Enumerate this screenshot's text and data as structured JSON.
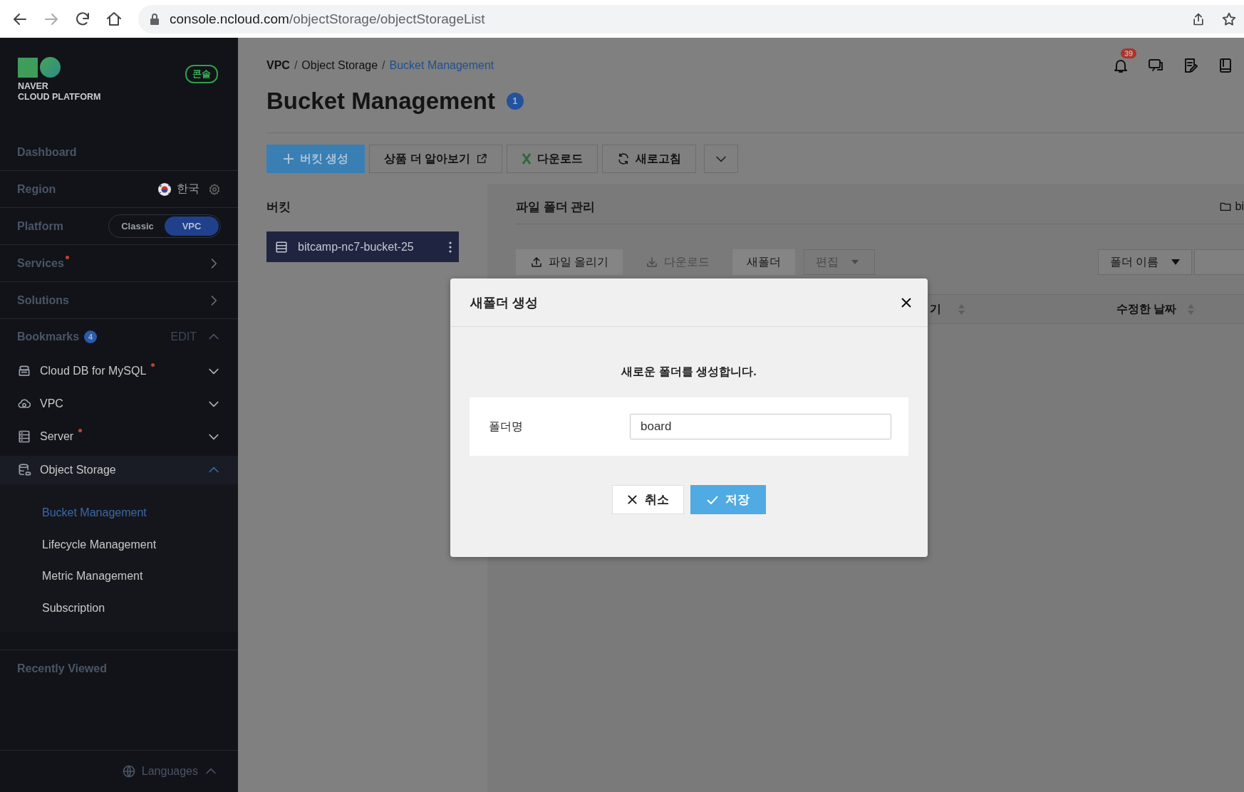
{
  "browser": {
    "url_host": "console.ncloud.com",
    "url_path": "/objectStorage/objectStorageList"
  },
  "sidebar": {
    "logo_lines": [
      "NAVER",
      "CLOUD PLATFORM"
    ],
    "console_badge": "콘솔",
    "nav": [
      {
        "kind": "link",
        "label": "Dashboard"
      },
      {
        "kind": "region",
        "label": "Region",
        "value": "한국"
      },
      {
        "kind": "platform",
        "label": "Platform",
        "options": [
          {
            "label": "Classic",
            "selected": false
          },
          {
            "label": "VPC",
            "selected": true
          }
        ]
      },
      {
        "kind": "menu",
        "label": "Services",
        "dot": true
      },
      {
        "kind": "menu",
        "label": "Solutions",
        "dot": false
      }
    ],
    "bookmarks": {
      "label": "Bookmarks",
      "count": "4",
      "edit": "EDIT",
      "expanded": true,
      "items": [
        {
          "label": "Cloud DB for MySQL",
          "dot": true,
          "expanded": false
        },
        {
          "label": "VPC",
          "dot": false,
          "expanded": false
        },
        {
          "label": "Server",
          "dot": true,
          "expanded": false
        },
        {
          "label": "Object Storage",
          "dot": false,
          "expanded": true,
          "children": [
            {
              "label": "Bucket Management",
              "selected": true
            },
            {
              "label": "Lifecycle Management",
              "selected": false
            },
            {
              "label": "Metric Management",
              "selected": false
            },
            {
              "label": "Subscription",
              "selected": false
            }
          ]
        }
      ]
    },
    "recently_viewed": "Recently Viewed",
    "languages": "Languages"
  },
  "main": {
    "breadcrumb": [
      {
        "label": "VPC",
        "current": false,
        "separator": "/"
      },
      {
        "label": "Object Storage",
        "current": false,
        "separator": "/"
      },
      {
        "label": "Bucket Management",
        "current": true
      }
    ],
    "notification_count": "39",
    "title": "Bucket Management",
    "title_badge": "1",
    "toolbar": [
      {
        "kind": "primary",
        "label": "버킷 생성"
      },
      {
        "kind": "external",
        "label": "상품 더 알아보기"
      },
      {
        "kind": "excel",
        "label": "다운로드"
      },
      {
        "kind": "refresh",
        "label": "새로고침"
      },
      {
        "kind": "more"
      }
    ],
    "buckets": {
      "title": "버킷",
      "items": [
        {
          "name": "bitcamp-nc7-bucket-25",
          "selected": true
        }
      ]
    },
    "files": {
      "title": "파일 폴더 관리",
      "path": "bi",
      "actions": [
        {
          "kind": "upload",
          "label": "파일 올리기",
          "disabled": false
        },
        {
          "kind": "download",
          "label": "다운로드",
          "disabled": true
        },
        {
          "kind": "plain",
          "label": "새폴더",
          "disabled": false
        },
        {
          "kind": "dropdown",
          "label": "편집",
          "disabled": true
        }
      ],
      "sort_select": "폴더 이름",
      "columns": [
        {
          "label": "기"
        },
        {
          "label": "수정한 날짜"
        }
      ]
    }
  },
  "dialog": {
    "title": "새폴더 생성",
    "message": "새로운 폴더를 생성합니다.",
    "field_label": "폴더명",
    "field_value": "board",
    "buttons": [
      {
        "kind": "cancel",
        "label": "취소"
      },
      {
        "kind": "confirm",
        "label": "저장"
      }
    ]
  }
}
